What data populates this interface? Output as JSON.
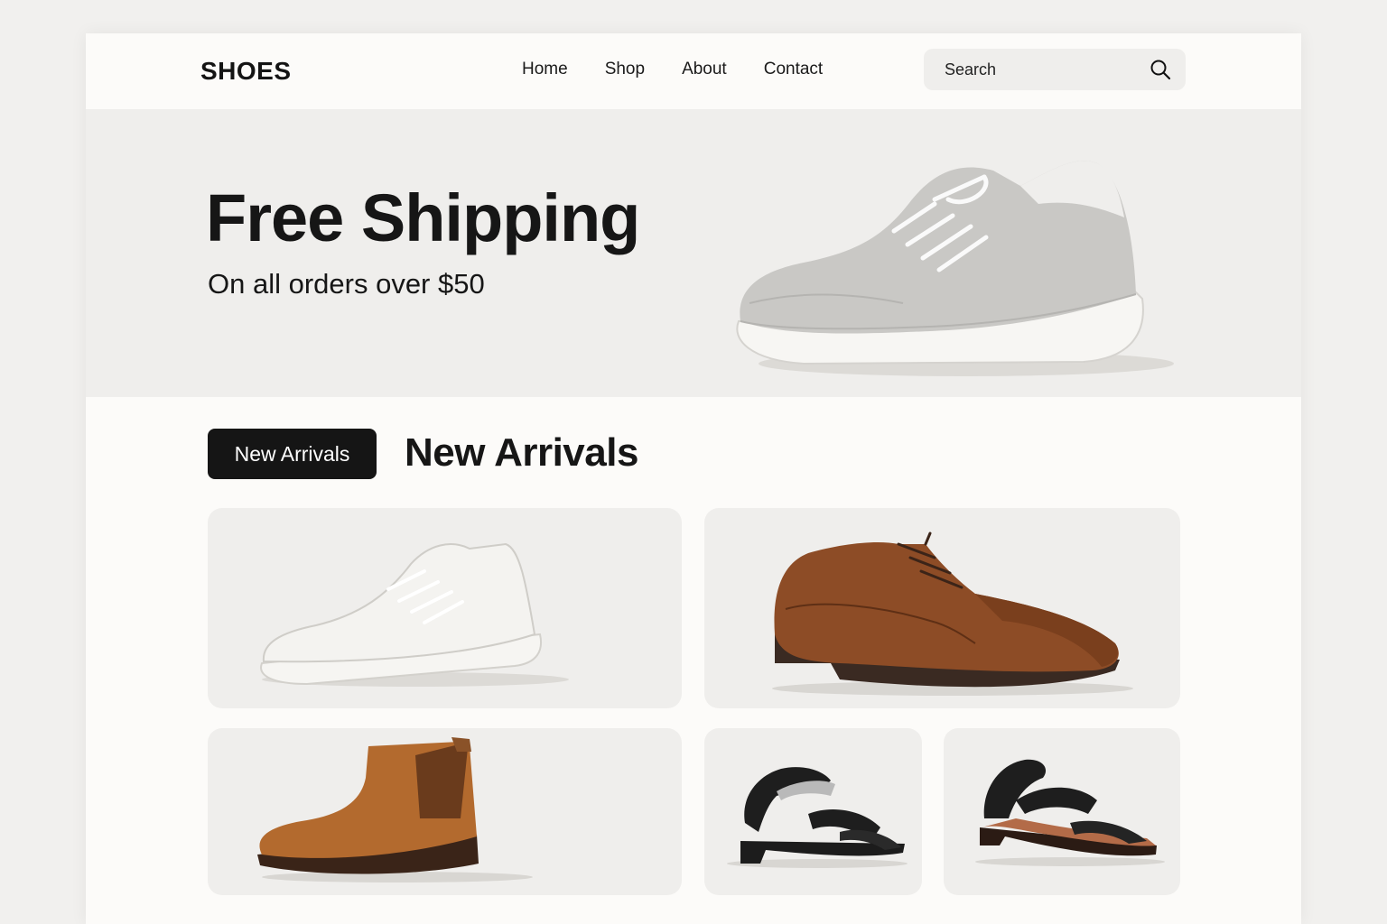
{
  "header": {
    "logo": "SHOES",
    "nav": [
      "Home",
      "Shop",
      "About",
      "Contact"
    ],
    "search": {
      "placeholder": "Search",
      "icon": "search-icon"
    }
  },
  "hero": {
    "title": "Free Shipping",
    "subtitle": "On all orders over $50"
  },
  "arrivals": {
    "badge": "New Arrivals",
    "title": "New Arrivals"
  },
  "colors": {
    "background": "#f1f0ee",
    "page": "#fcfbf9",
    "panel": "#efeeec",
    "accent": "#151515"
  }
}
